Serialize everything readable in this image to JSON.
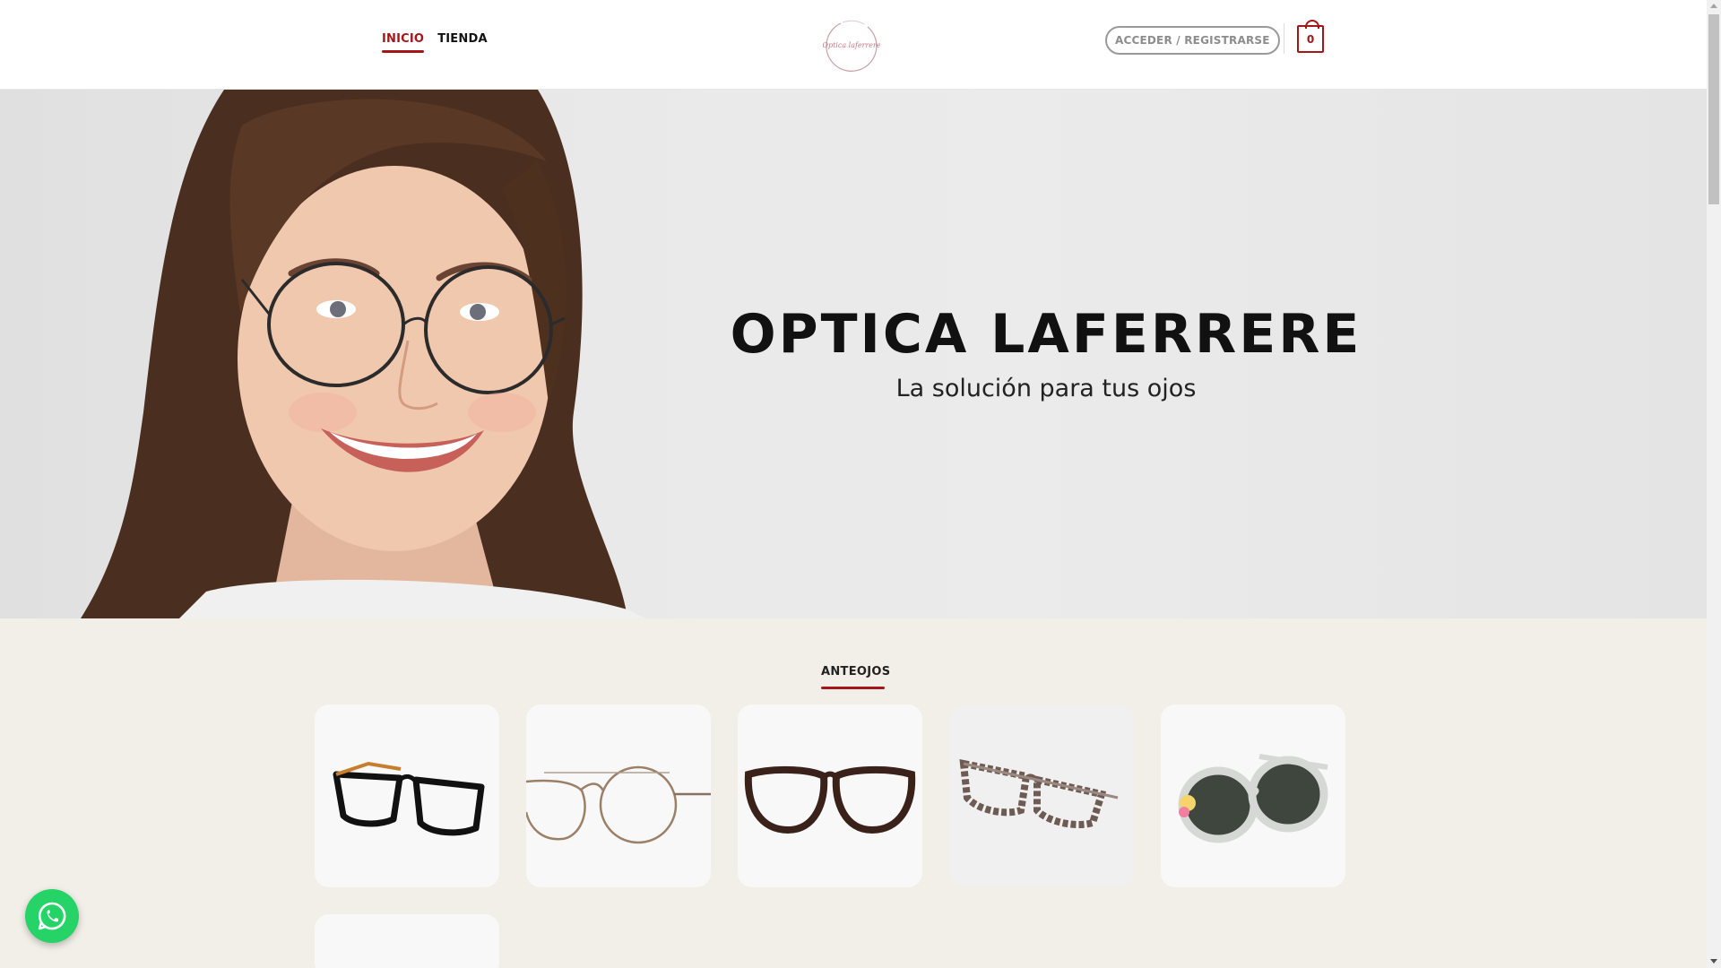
{
  "header": {
    "nav": [
      {
        "label": "INICIO",
        "active": true
      },
      {
        "label": "TIENDA",
        "active": false
      }
    ],
    "logo_text": "Optica Laferrere",
    "login_label": "ACCEDER / REGISTRARSE",
    "cart_count": "0"
  },
  "hero": {
    "title": "OPTICA LAFERRERE",
    "subtitle": "La solución para tus ojos"
  },
  "products": {
    "section_title": "ANTEOJOS",
    "items": [
      {
        "icon": "black-rectangular-glasses"
      },
      {
        "icon": "gold-round-wire-glasses"
      },
      {
        "icon": "tortoise-round-glasses"
      },
      {
        "icon": "tortoise-cateye-glasses"
      },
      {
        "icon": "kids-sunglasses"
      },
      {
        "icon": "product-placeholder"
      }
    ]
  },
  "colors": {
    "accent": "#a4161a",
    "section_bg": "#f2efe9",
    "whatsapp": "#25d366"
  }
}
